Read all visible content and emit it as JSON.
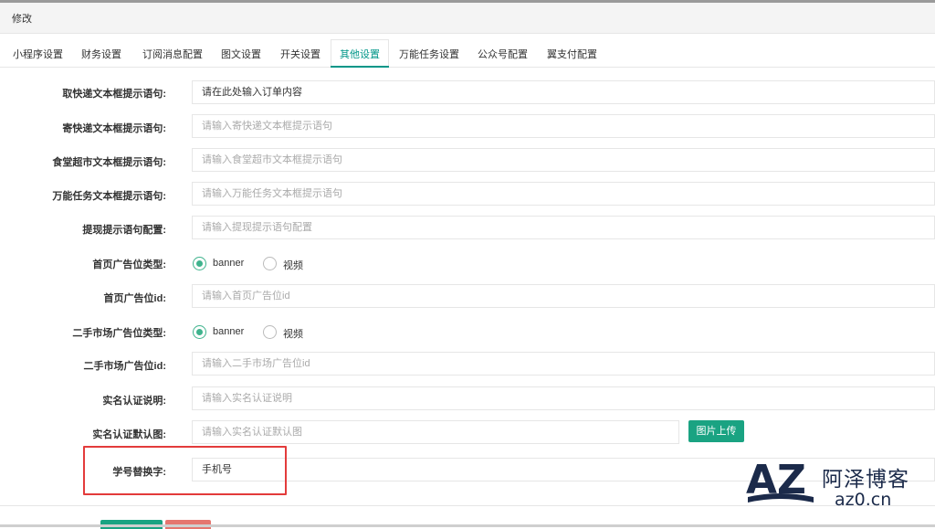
{
  "header": {
    "title": "修改"
  },
  "tabs": [
    {
      "label": "小程序设置"
    },
    {
      "label": "财务设置"
    },
    {
      "label": "订阅消息配置"
    },
    {
      "label": "图文设置"
    },
    {
      "label": "开关设置"
    },
    {
      "label": "其他设置",
      "active": true
    },
    {
      "label": "万能任务设置"
    },
    {
      "label": "公众号配置"
    },
    {
      "label": "翼支付配置"
    }
  ],
  "form": {
    "express_pick": {
      "label": "取快递文本框提示语句:",
      "value": "请在此处输入订单内容"
    },
    "express_send": {
      "label": "寄快递文本框提示语句:",
      "placeholder": "请输入寄快递文本框提示语句"
    },
    "canteen": {
      "label": "食堂超市文本框提示语句:",
      "placeholder": "请输入食堂超市文本框提示语句"
    },
    "universal_task": {
      "label": "万能任务文本框提示语句:",
      "placeholder": "请输入万能任务文本框提示语句"
    },
    "withdraw": {
      "label": "提现提示语句配置:",
      "placeholder": "请输入提现提示语句配置"
    },
    "home_ad_type": {
      "label": "首页广告位类型:",
      "options": [
        "banner",
        "视频"
      ],
      "selected": "banner"
    },
    "home_ad_id": {
      "label": "首页广告位id:",
      "placeholder": "请输入首页广告位id"
    },
    "market_ad_type": {
      "label": "二手市场广告位类型:",
      "options": [
        "banner",
        "视频"
      ],
      "selected": "banner"
    },
    "market_ad_id": {
      "label": "二手市场广告位id:",
      "placeholder": "请输入二手市场广告位id"
    },
    "realname_desc": {
      "label": "实名认证说明:",
      "placeholder": "请输入实名认证说明"
    },
    "realname_image": {
      "label": "实名认证默认图:",
      "placeholder": "请输入实名认证默认图",
      "upload_label": "图片上传"
    },
    "student_id_replace": {
      "label": "学号替换字:",
      "value": "手机号"
    }
  },
  "watermark": {
    "name": "阿泽博客",
    "url": "az0.cn",
    "logo_text": "AZ"
  },
  "colors": {
    "accent": "#009688",
    "button_green": "#1aa382",
    "radio_green": "#3fb38d",
    "highlight_red": "#e33b3b"
  }
}
